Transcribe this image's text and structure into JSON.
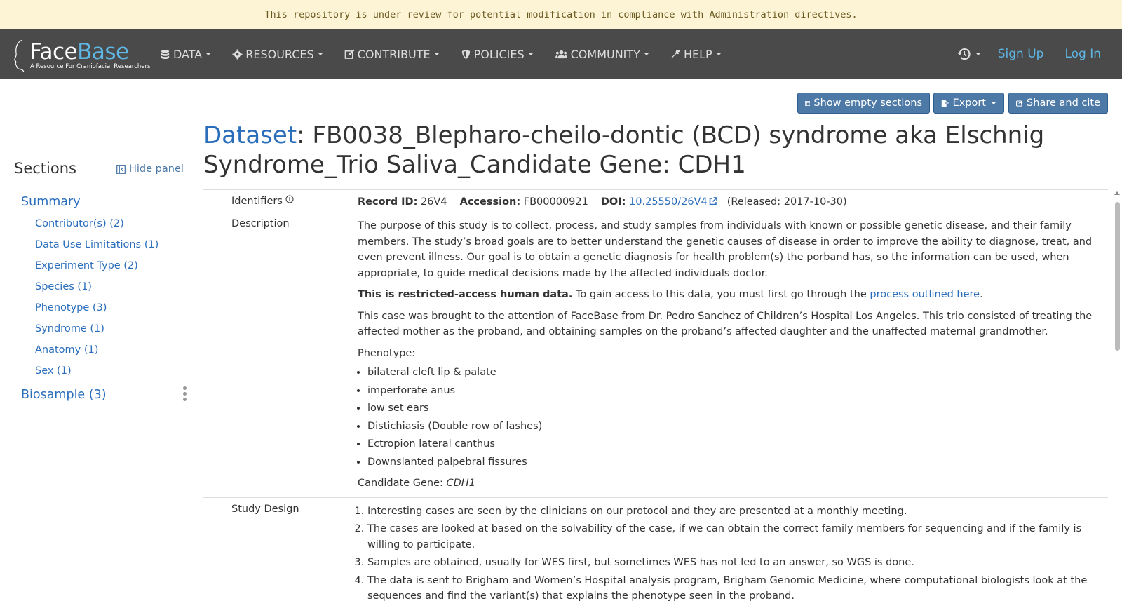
{
  "banner": "This repository is under review for potential modification in compliance with Administration directives.",
  "brand": {
    "name_part1": "Face",
    "name_part2": "Base",
    "tagline": "A Resource For Craniofacial Researchers"
  },
  "nav": {
    "items": [
      {
        "label": "DATA",
        "icon": "database-icon"
      },
      {
        "label": "RESOURCES",
        "icon": "cog-icon"
      },
      {
        "label": "CONTRIBUTE",
        "icon": "edit-icon"
      },
      {
        "label": "POLICIES",
        "icon": "shield-icon"
      },
      {
        "label": "COMMUNITY",
        "icon": "users-icon"
      },
      {
        "label": "HELP",
        "icon": "wrench-icon"
      }
    ],
    "signup": "Sign Up",
    "login": "Log In"
  },
  "toolbar": {
    "show_empty": "Show empty sections",
    "export": "Export",
    "share": "Share and cite"
  },
  "sidebar": {
    "title": "Sections",
    "hide_panel": "Hide panel",
    "summary": "Summary",
    "items": [
      "Contributor(s) (2)",
      "Data Use Limitations (1)",
      "Experiment Type (2)",
      "Species (1)",
      "Phenotype (3)",
      "Syndrome (1)",
      "Anatomy (1)",
      "Sex (1)"
    ],
    "biosample": "Biosample (3)"
  },
  "page": {
    "title_link": "Dataset",
    "title_rest": ": FB0038_Blepharo-cheilo-dontic (BCD) syndrome aka Elschnig Syndrome_Trio Saliva_Candidate Gene: CDH1"
  },
  "identifiers": {
    "label": "Identifiers",
    "record_id_key": "Record ID:",
    "record_id": "26V4",
    "accession_key": "Accession:",
    "accession": "FB00000921",
    "doi_key": "DOI:",
    "doi": "10.25550/26V4",
    "released": "(Released: 2017-10-30)"
  },
  "description": {
    "label": "Description",
    "p1": "The purpose of this study is to collect, process, and study samples from individuals with known or possible genetic disease, and their family members. The study’s broad goals are to better understand the genetic causes of disease in order to improve the ability to diagnose, treat, and even prevent illness. Our goal is to obtain a genetic diagnosis for health problem(s) the porband has, so the information can be used, when appropriate, to guide medical decisions made by the affected individuals doctor.",
    "p2_bold": "This is restricted-access human data.",
    "p2_text": " To gain access to this data, you must first go through the ",
    "p2_link": "process outlined here",
    "p2_end": ".",
    "p3": "This case was brought to the attention of FaceBase from Dr. Pedro Sanchez of Children’s Hospital Los Angeles. This trio consisted of treating the affected mother as the proband, and obtaining samples on the proband’s affected daughter and the unaffected maternal grandmother.",
    "phenotype_label": "Phenotype:",
    "phenotypes": [
      "bilateral cleft lip & palate",
      "imperforate anus",
      "low set ears",
      "Distichiasis (Double row of lashes)",
      "Ectropion lateral canthus",
      "Downslanted palpebral fissures"
    ],
    "gene_label": "Candidate Gene: ",
    "gene": "CDH1"
  },
  "study_design": {
    "label": "Study Design",
    "steps": [
      "Interesting cases are seen by the clinicians on our protocol and they are presented at a monthly meeting.",
      "The cases are looked at based on the solvability of the case, if we can obtain the correct family members for sequencing and if the family is willing to participate.",
      "Samples are obtained, usually for WES first, but sometimes WES has not led to an answer, so WGS is done.",
      "The data is sent to Brigham and Women’s Hospital analysis program, Brigham Genomic Medicine, where computational biologists look at the sequences and find the variant(s) that explains the phenotype seen in the proband."
    ]
  },
  "colors": {
    "link": "#2a6ebb",
    "navbar": "#4a4a4a",
    "banner": "#fdf4d6",
    "button": "#4d79a6"
  }
}
